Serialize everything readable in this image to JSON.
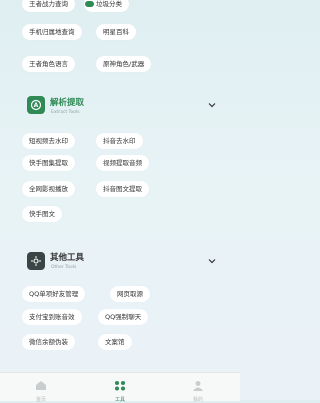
{
  "top_chips": {
    "row0": [
      "王者战力查询",
      "垃圾分类"
    ],
    "row1": [
      "手机归属地查询",
      "明星百科"
    ],
    "row2": [
      "王者角色语言",
      "原神角色/武器"
    ]
  },
  "extract": {
    "title": "解析提取",
    "subtitle": "Extract Tools",
    "items": [
      "短视频去水印",
      "抖音去水印",
      "快手图集提取",
      "视频提取音频",
      "全网影视播放",
      "抖音图文提取",
      "快手图文"
    ]
  },
  "other": {
    "title": "其他工具",
    "subtitle": "Other Tools",
    "items": [
      "QQ单项好友管理",
      "网页取源",
      "支付宝到账音效",
      "QQ强制聊天",
      "微信余额伪装",
      "文案馆"
    ]
  },
  "tabs": [
    {
      "label": "首页",
      "icon": "home-icon"
    },
    {
      "label": "工具",
      "icon": "grid-icon",
      "active": true
    },
    {
      "label": "我的",
      "icon": "user-icon"
    }
  ],
  "colors": {
    "accent": "#2f8a55",
    "extract_icon_bg": "#2f8a55",
    "other_icon_bg": "#3a4546"
  }
}
